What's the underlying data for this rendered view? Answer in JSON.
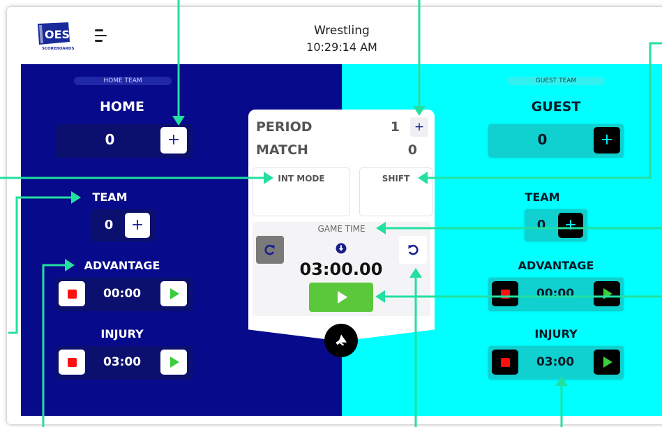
{
  "header": {
    "logo_text": "OES",
    "logo_subtext": "SCOREBOARDS",
    "title": "Wrestling",
    "time": "10:29:14 AM"
  },
  "home": {
    "team_pill": "HOME TEAM",
    "name": "HOME",
    "score": "0",
    "team_label": "TEAM",
    "team_points": "0",
    "advantage_label": "ADVANTAGE",
    "advantage_time": "00:00",
    "injury_label": "INJURY",
    "injury_time": "03:00"
  },
  "guest": {
    "team_pill": "GUEST TEAM",
    "name": "GUEST",
    "score": "0",
    "team_label": "TEAM",
    "team_points": "0",
    "advantage_label": "ADVANTAGE",
    "advantage_time": "00:00",
    "injury_label": "INJURY",
    "injury_time": "03:00"
  },
  "center": {
    "period_label": "PERIOD",
    "period_value": "1",
    "match_label": "MATCH",
    "match_value": "0",
    "int_mode_label": "INT MODE",
    "shift_label": "SHIFT",
    "game_time_label": "GAME TIME",
    "game_time_value": "03:00.00"
  },
  "icons": {
    "plus": "+",
    "menu": "menu-icon",
    "redo": "redo-icon",
    "undo": "undo-icon",
    "horn": "megaphone-icon",
    "down": "arrow-down-circle-icon"
  },
  "colors": {
    "home_panel": "#070a8a",
    "guest_panel": "#00ffff",
    "annotation": "#22e0a0",
    "play_green": "#5bc83c",
    "stop_red": "#ff1010"
  }
}
